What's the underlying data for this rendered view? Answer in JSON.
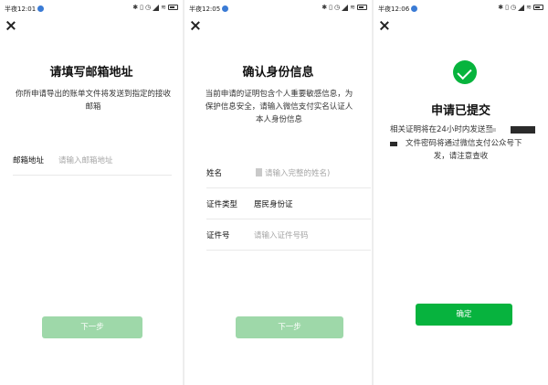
{
  "screens": [
    {
      "status_time": "半夜12:01",
      "title": "请填写邮箱地址",
      "description": "你所申请导出的账单文件将发送到指定的接收邮箱",
      "email_label": "邮箱地址",
      "email_placeholder": "请输入邮箱地址",
      "email_value": "",
      "next_button": "下一步"
    },
    {
      "status_time": "半夜12:05",
      "title": "确认身份信息",
      "description": "当前申请的证明包含个人重要敏感信息，为保护信息安全，请输入微信支付实名认证人本人身份信息",
      "name_label": "姓名",
      "name_placeholder": "请输入完整的姓名)",
      "id_type_label": "证件类型",
      "id_type_value": "居民身份证",
      "id_number_label": "证件号",
      "id_number_placeholder": "请输入证件号码",
      "next_button": "下一步"
    },
    {
      "status_time": "半夜12:06",
      "title": "申请已提交",
      "message_line1": "相关证明将在24小时内发送至",
      "message_line2": "文件密码将通过微信支付公众号下",
      "message_line3": "发，请注意查收",
      "confirm_button": "确定"
    }
  ],
  "colors": {
    "brand_green": "#07b33e",
    "disabled_green": "#9ed8a9",
    "placeholder_gray": "#a6a6a6"
  },
  "icons": {
    "close": "close-icon",
    "success": "check-circle-icon"
  }
}
